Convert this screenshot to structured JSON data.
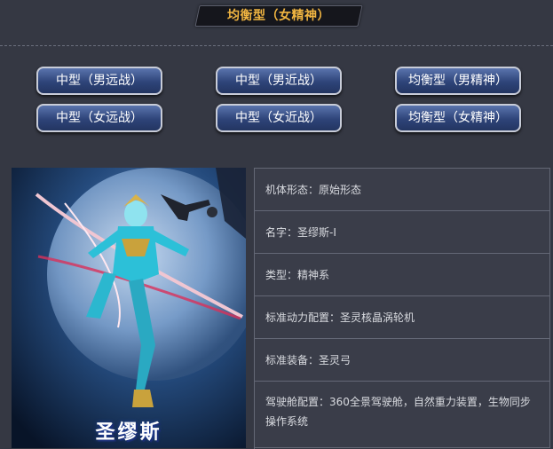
{
  "header": {
    "title": "均衡型（女精神）"
  },
  "buttons": [
    "中型（男远战）",
    "中型（男近战）",
    "均衡型（男精神）",
    "中型（女远战）",
    "中型（女近战）",
    "均衡型（女精神）"
  ],
  "character": {
    "name_logo": "圣缪斯"
  },
  "info": [
    "机体形态：原始形态",
    "名字：圣缪斯-Ⅰ",
    "类型：精神系",
    "标准动力配置：圣灵核晶涡轮机",
    "标准装备：圣灵弓",
    "驾驶舱配置：360全景驾驶舱，自然重力装置，生物同步操作系统"
  ],
  "colors": {
    "accent": "#f1b541",
    "button": "#2e4479",
    "panel": "#3a3d49"
  }
}
